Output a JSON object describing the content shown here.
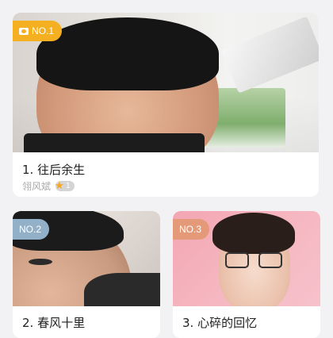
{
  "cards": [
    {
      "rank_label": "NO.1",
      "title": "1. 往后余生",
      "singer": "翎风斌",
      "level": "1",
      "rank_icon": "camera-icon",
      "rank_color": "#f4b020"
    },
    {
      "rank_label": "NO.2",
      "title": "2. 春风十里",
      "rank_color": "#93b0c9"
    },
    {
      "rank_label": "NO.3",
      "title": "3. 心碎的回忆",
      "rank_color": "#e49a78"
    }
  ],
  "colors": {
    "background": "#f2f2f4",
    "star": "#f5a623"
  }
}
